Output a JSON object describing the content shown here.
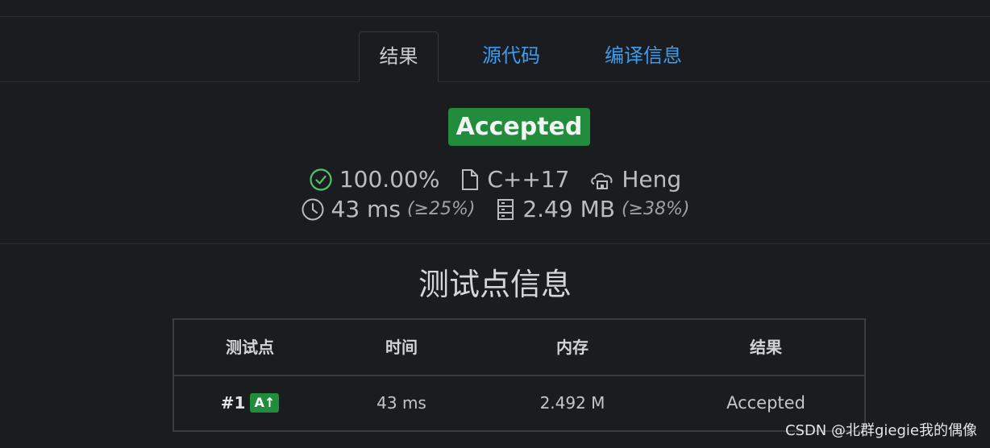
{
  "tabs": [
    {
      "label": "结果",
      "active": true
    },
    {
      "label": "源代码",
      "active": false
    },
    {
      "label": "编译信息",
      "active": false
    }
  ],
  "verdict": "Accepted",
  "stats": {
    "score": "100.00%",
    "language": "C++17",
    "user": "Heng",
    "time": "43 ms",
    "time_pct": "(≥25%)",
    "memory": "2.49 MB",
    "memory_pct": "(≥38%)"
  },
  "testcases": {
    "title": "测试点信息",
    "headers": [
      "测试点",
      "时间",
      "内存",
      "结果"
    ],
    "rows": [
      {
        "id": "#1",
        "badge": "A↑",
        "time": "43 ms",
        "memory": "2.492 M",
        "result": "Accepted"
      }
    ]
  },
  "watermark": "CSDN @北群giegie我的偶像",
  "colors": {
    "accent": "#3b9cf0",
    "accepted_bg": "#218c3c",
    "accepted_text": "#52c26b",
    "background": "#1b1c1f"
  },
  "icons": {
    "score": "check-circle-icon",
    "language": "file-icon",
    "user": "cloud-house-icon",
    "time": "clock-icon",
    "memory": "server-icon"
  }
}
